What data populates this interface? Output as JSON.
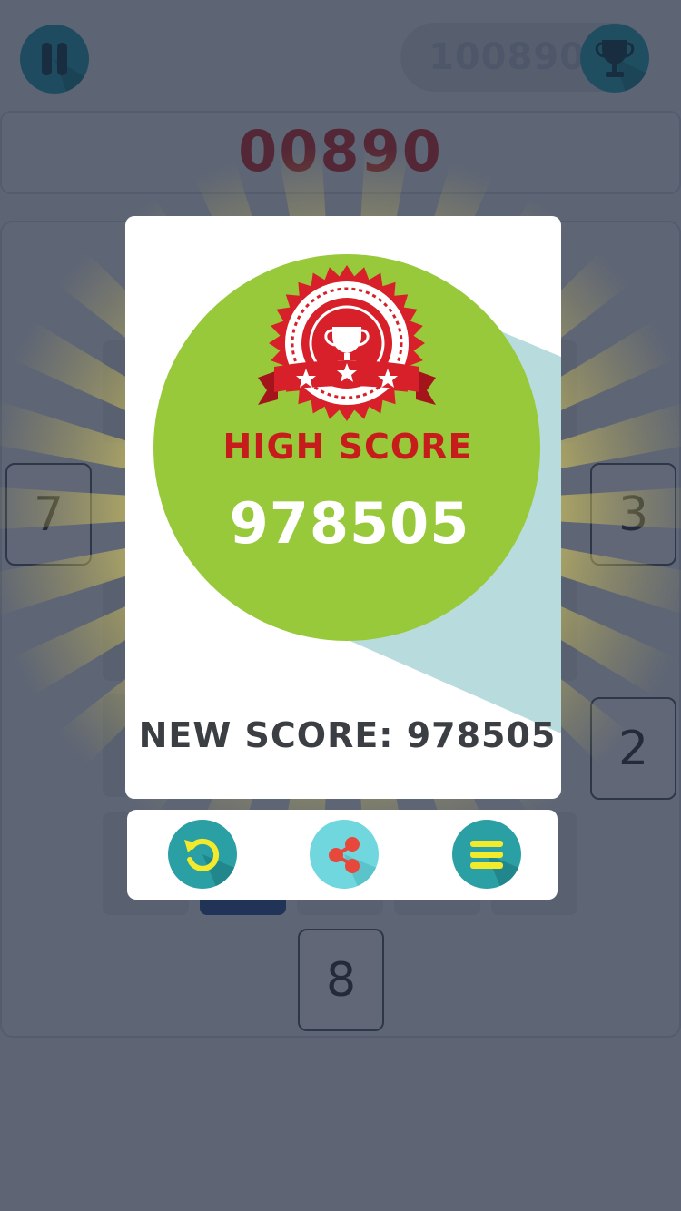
{
  "header": {
    "pause_icon": "pause-icon",
    "best_score": "100890",
    "trophy_icon": "trophy-icon"
  },
  "current_score": "00890",
  "board": {
    "tiles": {
      "left": "7",
      "right_top": "3",
      "right_bottom": "2",
      "bottom": "8"
    }
  },
  "dialog": {
    "badge_icon": "high-score-badge-trophy-icon",
    "title": "HIGH SCORE",
    "high_score": "978505",
    "new_score_label": "NEW SCORE: 978505"
  },
  "actions": {
    "replay_icon": "replay-icon",
    "share_icon": "share-icon",
    "menu_icon": "menu-icon"
  },
  "colors": {
    "accent_teal": "#1f9aa8",
    "green_circle": "#97c93a",
    "badge_red": "#c71c1c",
    "icon_yellow": "#f3ea2c",
    "share_red": "#e8483b",
    "share_bg": "#6fd7dd"
  }
}
